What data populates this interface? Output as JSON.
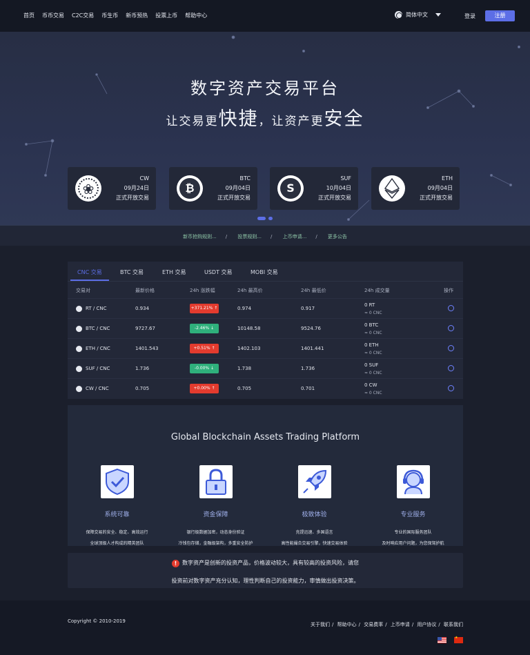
{
  "nav": {
    "links": [
      "首页",
      "币币交易",
      "C2C交易",
      "币生币",
      "新币预热",
      "投票上币",
      "帮助中心"
    ],
    "language": "简体中文",
    "login": "登录",
    "register": "注册"
  },
  "hero": {
    "title": "数字资产交易平台",
    "subtitle": {
      "p1": "让交易更",
      "b1": "快捷",
      "p2": "，让资产更",
      "b2": "安全"
    }
  },
  "coins": [
    {
      "name": "CW",
      "date": "09月24日",
      "note": "正式开放交易",
      "icon": "cw-logo-icon"
    },
    {
      "name": "BTC",
      "date": "09月04日",
      "note": "正式开放交易",
      "icon": "bitcoin-icon"
    },
    {
      "name": "SUF",
      "date": "10月04日",
      "note": "正式开放交易",
      "icon": "suf-logo-icon"
    },
    {
      "name": "ETH",
      "date": "09月04日",
      "note": "正式开放交易",
      "icon": "ethereum-icon"
    }
  ],
  "notice": {
    "items": [
      "新币抢购规则...",
      "投票规则...",
      "上币申请...",
      "更多公告"
    ]
  },
  "market": {
    "tabs": [
      "CNC 交易",
      "BTC 交易",
      "ETH 交易",
      "USDT 交易",
      "MOBI 交易"
    ],
    "headers": [
      "交易对",
      "最新价格",
      "24h 涨跌幅",
      "24h 最高价",
      "24h 最低价",
      "24h 成交量",
      "操作"
    ],
    "rows": [
      {
        "pair": "RT / CNC",
        "price": "0.934",
        "change": "+371.21%",
        "dir": "up",
        "high": "0.974",
        "low": "0.917",
        "vol": "0 RT",
        "vol_cnc": "≈ 0 CNC"
      },
      {
        "pair": "BTC / CNC",
        "price": "9727.67",
        "change": "-2.46%",
        "dir": "down",
        "high": "10148.58",
        "low": "9524.76",
        "vol": "0 BTC",
        "vol_cnc": "≈ 0 CNC"
      },
      {
        "pair": "ETH / CNC",
        "price": "1401.543",
        "change": "+0.51%",
        "dir": "up",
        "high": "1402.103",
        "low": "1401.441",
        "vol": "0 ETH",
        "vol_cnc": "≈ 0 CNC"
      },
      {
        "pair": "SUF / CNC",
        "price": "1.736",
        "change": "-0.00%",
        "dir": "down",
        "high": "1.738",
        "low": "1.736",
        "vol": "0 SUF",
        "vol_cnc": "≈ 0 CNC"
      },
      {
        "pair": "CW / CNC",
        "price": "0.705",
        "change": "+0.00%",
        "dir": "up",
        "high": "0.705",
        "low": "0.701",
        "vol": "0 CW",
        "vol_cnc": "≈ 0 CNC"
      }
    ]
  },
  "features": {
    "title": "Global Blockchain Assets Trading Platform",
    "items": [
      {
        "name": "系统可靠",
        "d1": "保障交易的安全、稳定、高效运行",
        "d2": "全球顶级人才构成的精英团队",
        "icon": "shield-check-icon"
      },
      {
        "name": "资金保障",
        "d1": "银行级数据加密，动态身份验证",
        "d2": "冷钱包存储，金融级架构，多重安全防护",
        "icon": "padlock-icon"
      },
      {
        "name": "极致体验",
        "d1": "充提迅速、多国语言",
        "d2": "高性能撮合交易引擎，快速交易体验",
        "icon": "rocket-icon"
      },
      {
        "name": "专业服务",
        "d1": "专业的国际服务团队",
        "d2": "及时响应用户问题，为您保驾护航",
        "icon": "support-agent-icon"
      }
    ]
  },
  "risk": {
    "line1": "数字资产是创新的投资产品，价格波动较大，具有较高的投资风险，请您",
    "line2": "投资前对数字资产充分认知，理性判断自己的投资能力，审慎做出投资决策。"
  },
  "footer": {
    "copyright": "Copyright © 2010-2019",
    "links": [
      "关于我们",
      "帮助中心",
      "交易费率",
      "上币申请",
      "用户协议",
      "联系我们"
    ]
  },
  "colors": {
    "accent": "#5c6ee6",
    "up": "#e33b2e",
    "down": "#2fb07c",
    "notice": "#8fc7a8"
  }
}
